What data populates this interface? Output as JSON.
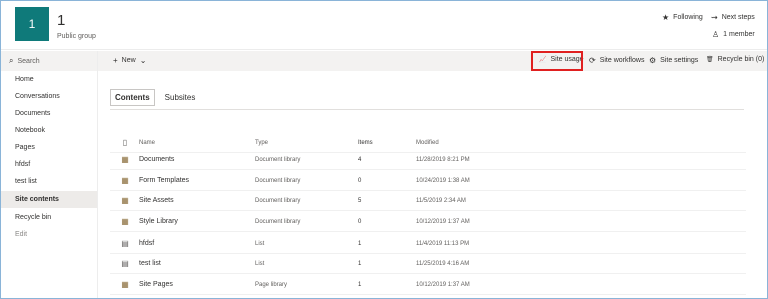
{
  "site": {
    "logo_text": "1",
    "title": "1",
    "subtitle": "Public group"
  },
  "header": {
    "following_icon": "★",
    "following_label": "Following",
    "nextsteps_icon": "⇝",
    "nextsteps_label": "Next steps",
    "member_icon": "♙",
    "member_label": "1 member"
  },
  "search": {
    "icon": "⌕",
    "label": "Search"
  },
  "commandbar": {
    "new_icon": "+",
    "new_label": "New",
    "new_chevron": "⌄",
    "site_usage_icon": "📈",
    "site_usage": "Site usage",
    "site_workflows_icon": "⟳",
    "site_workflows": "Site workflows",
    "site_settings_icon": "⚙",
    "site_settings": "Site settings",
    "recycle_icon": "🗑",
    "recycle_bin": "Recycle bin (0)"
  },
  "nav": {
    "items": [
      {
        "label": "Home"
      },
      {
        "label": "Conversations"
      },
      {
        "label": "Documents"
      },
      {
        "label": "Notebook"
      },
      {
        "label": "Pages"
      },
      {
        "label": "hfdsf"
      },
      {
        "label": "test list"
      },
      {
        "label": "Site contents"
      },
      {
        "label": "Recycle bin"
      },
      {
        "label": "Edit"
      }
    ]
  },
  "tabs": {
    "contents": "Contents",
    "subsites": "Subsites"
  },
  "table": {
    "headers": {
      "icon": "▯",
      "name": "Name",
      "type": "Type",
      "items": "Items",
      "modified": "Modified"
    },
    "rows": [
      {
        "icon": "▦",
        "name": "Documents",
        "type": "Document library",
        "items": "4",
        "modified": "11/28/2019 8:21 PM"
      },
      {
        "icon": "▦",
        "name": "Form Templates",
        "type": "Document library",
        "items": "0",
        "modified": "10/24/2019 1:38 AM"
      },
      {
        "icon": "▦",
        "name": "Site Assets",
        "type": "Document library",
        "items": "5",
        "modified": "11/5/2019 2:34 AM"
      },
      {
        "icon": "▦",
        "name": "Style Library",
        "type": "Document library",
        "items": "0",
        "modified": "10/12/2019 1:37 AM"
      },
      {
        "icon": "▤",
        "name": "hfdsf",
        "type": "List",
        "items": "1",
        "modified": "11/4/2019 11:13 PM"
      },
      {
        "icon": "▤",
        "name": "test list",
        "type": "List",
        "items": "1",
        "modified": "11/25/2019 4:16 AM"
      },
      {
        "icon": "▦",
        "name": "Site Pages",
        "type": "Page library",
        "items": "1",
        "modified": "10/12/2019 1:37 AM"
      }
    ]
  }
}
